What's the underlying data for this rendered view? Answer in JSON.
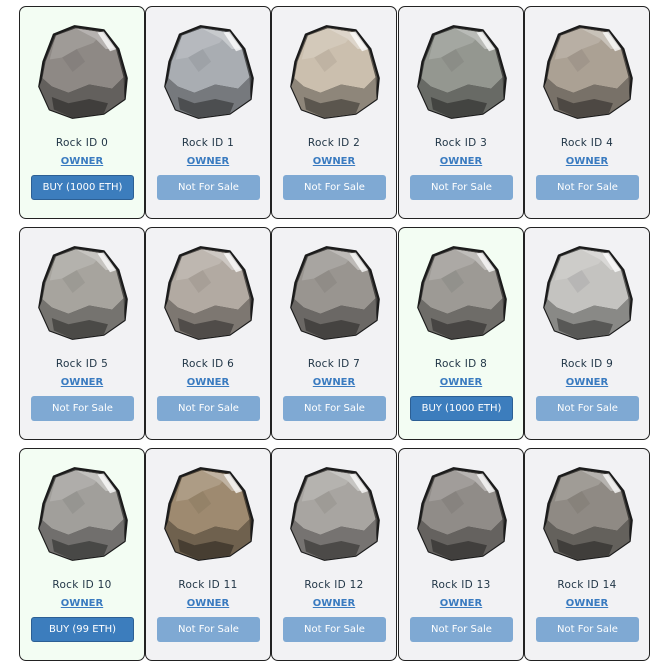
{
  "rocks": [
    {
      "id_label": "Rock ID 0",
      "owner_label": "OWNER",
      "button_label": "BUY (1000 ETH)",
      "for_sale": true,
      "color": "#8e8985"
    },
    {
      "id_label": "Rock ID 1",
      "owner_label": "OWNER",
      "button_label": "Not For Sale",
      "for_sale": false,
      "color": "#a9adb2"
    },
    {
      "id_label": "Rock ID 2",
      "owner_label": "OWNER",
      "button_label": "Not For Sale",
      "for_sale": false,
      "color": "#cbbfae"
    },
    {
      "id_label": "Rock ID 3",
      "owner_label": "OWNER",
      "button_label": "Not For Sale",
      "for_sale": false,
      "color": "#949790"
    },
    {
      "id_label": "Rock ID 4",
      "owner_label": "OWNER",
      "button_label": "Not For Sale",
      "for_sale": false,
      "color": "#aba194"
    },
    {
      "id_label": "Rock ID 5",
      "owner_label": "OWNER",
      "button_label": "Not For Sale",
      "for_sale": false,
      "color": "#a7a49e"
    },
    {
      "id_label": "Rock ID 6",
      "owner_label": "OWNER",
      "button_label": "Not For Sale",
      "for_sale": false,
      "color": "#b2aaa2"
    },
    {
      "id_label": "Rock ID 7",
      "owner_label": "OWNER",
      "button_label": "Not For Sale",
      "for_sale": false,
      "color": "#999590"
    },
    {
      "id_label": "Rock ID 8",
      "owner_label": "OWNER",
      "button_label": "BUY (1000 ETH)",
      "for_sale": true,
      "color": "#9d9a95"
    },
    {
      "id_label": "Rock ID 9",
      "owner_label": "OWNER",
      "button_label": "Not For Sale",
      "for_sale": false,
      "color": "#c4c3c0"
    },
    {
      "id_label": "Rock ID 10",
      "owner_label": "OWNER",
      "button_label": "BUY (99 ETH)",
      "for_sale": true,
      "color": "#a19f9b"
    },
    {
      "id_label": "Rock ID 11",
      "owner_label": "OWNER",
      "button_label": "Not For Sale",
      "for_sale": false,
      "color": "#9e8a70"
    },
    {
      "id_label": "Rock ID 12",
      "owner_label": "OWNER",
      "button_label": "Not For Sale",
      "for_sale": false,
      "color": "#a8a5a1"
    },
    {
      "id_label": "Rock ID 13",
      "owner_label": "OWNER",
      "button_label": "Not For Sale",
      "for_sale": false,
      "color": "#908c88"
    },
    {
      "id_label": "Rock ID 14",
      "owner_label": "OWNER",
      "button_label": "Not For Sale",
      "for_sale": false,
      "color": "#8f8a84"
    }
  ],
  "icon": "rock-icon"
}
